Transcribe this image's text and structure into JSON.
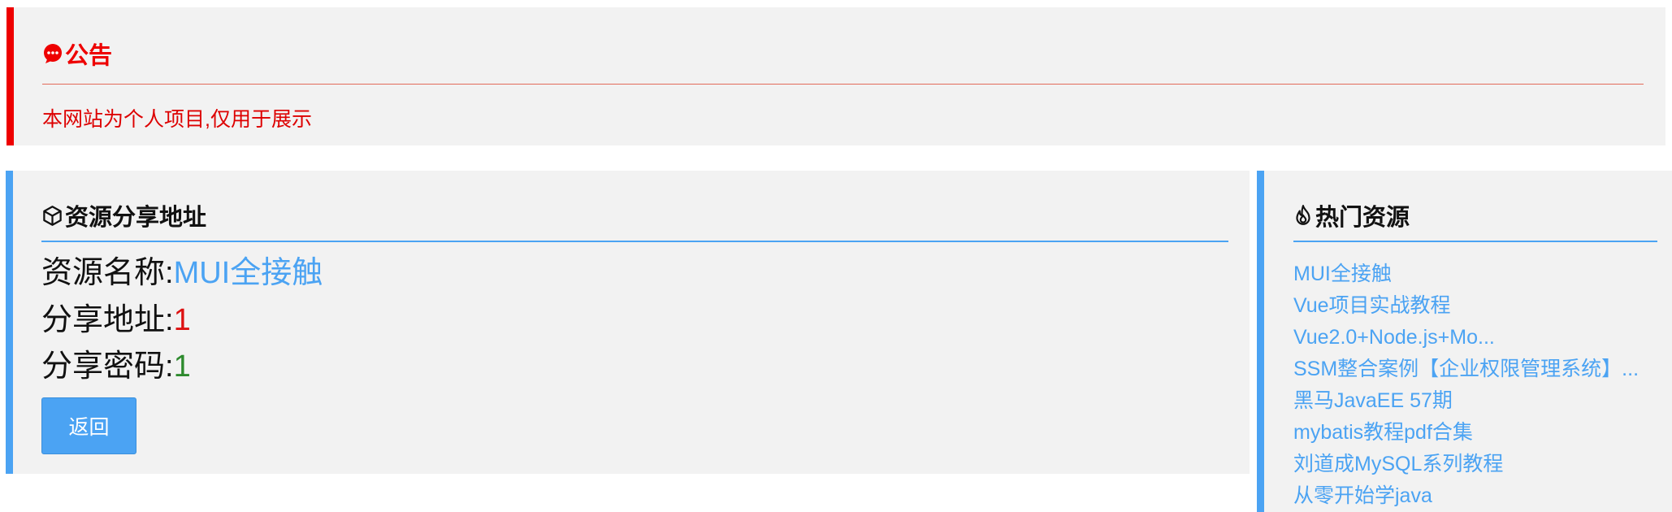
{
  "notice": {
    "title": "公告",
    "message": "本网站为个人项目,仅用于展示",
    "icon": "chat-bubble-icon",
    "accent": "#ee0000"
  },
  "share": {
    "title": "资源分享地址",
    "icon": "cube-icon",
    "name_label": "资源名称:",
    "name_value": "MUI全接触",
    "address_label": "分享地址:",
    "address_value": "1",
    "password_label": "分享密码:",
    "password_value": "1",
    "back_label": "返回",
    "accent": "#4ba3f3"
  },
  "hot": {
    "title": "热门资源",
    "icon": "flame-icon",
    "items": [
      "MUI全接触",
      "Vue项目实战教程",
      "Vue2.0+Node.js+Mo...",
      "SSM整合案例【企业权限管理系统】...",
      "黑马JavaEE 57期",
      "mybatis教程pdf合集",
      "刘道成MySQL系列教程",
      "从零开始学java"
    ]
  }
}
